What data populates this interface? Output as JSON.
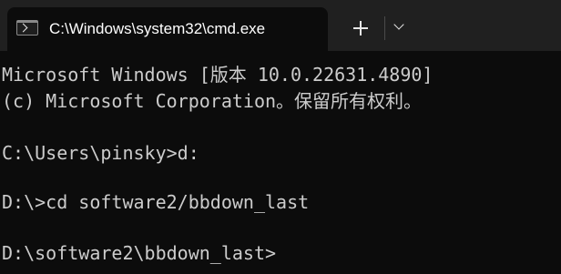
{
  "tab": {
    "title": "C:\\Windows\\system32\\cmd.exe",
    "icon": "cmd-icon"
  },
  "tab_actions": {
    "new_tab_icon": "plus-icon",
    "dropdown_icon": "chevron-down-icon"
  },
  "console": {
    "lines": [
      "Microsoft Windows [版本 10.0.22631.4890]",
      "(c) Microsoft Corporation。保留所有权利。",
      "",
      "C:\\Users\\pinsky>d:",
      "",
      "D:\\>cd software2/bbdown_last",
      "",
      "D:\\software2\\bbdown_last>"
    ]
  },
  "colors": {
    "background": "#0c0c0c",
    "titlebar": "#202020",
    "text": "#cccccc"
  }
}
